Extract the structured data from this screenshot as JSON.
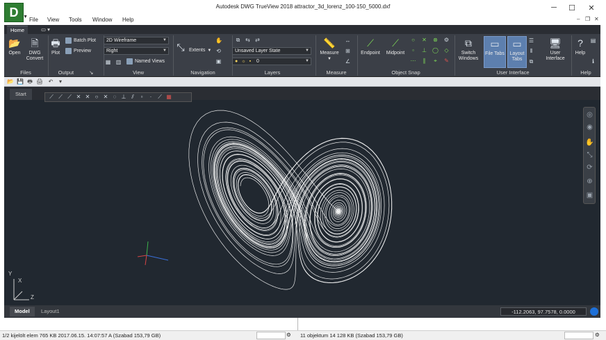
{
  "window": {
    "title": "Autodesk DWG TrueView 2018    attractor_3d_lorenz_100-150_5000.dxf",
    "logo_letter": "D"
  },
  "menu": [
    "File",
    "View",
    "Tools",
    "Window",
    "Help"
  ],
  "ribbon": {
    "tabs": [
      "Home"
    ],
    "panels": [
      "Files",
      "Output",
      "View",
      "Navigation",
      "Layers",
      "Measure",
      "Object Snap",
      "User Interface",
      "Help"
    ],
    "files": {
      "open": "Open",
      "dwg_convert_1": "DWG",
      "dwg_convert_2": "Convert"
    },
    "output": {
      "plot": "Plot",
      "batch_plot": "Batch Plot",
      "preview": "Preview"
    },
    "view": {
      "visual_style": "2D Wireframe",
      "view_dir": "Right",
      "named_views": "Named Views"
    },
    "navigation": {
      "extents": "Extents"
    },
    "layers": {
      "layer_state": "Unsaved Layer State",
      "layer_value": "0"
    },
    "measure": {
      "measure": "Measure"
    },
    "object_snap": {
      "endpoint": "Endpoint",
      "midpoint": "Midpoint"
    },
    "user_interface": {
      "switch_windows_1": "Switch",
      "switch_windows_2": "Windows",
      "file_tabs": "File Tabs",
      "layout_tabs_1": "Layout",
      "layout_tabs_2": "Tabs",
      "user_interface_1": "User",
      "user_interface_2": "Interface"
    },
    "help": {
      "help": "Help"
    }
  },
  "file_tabs": [
    "Start"
  ],
  "layout_tabs": [
    "Model",
    "Layout1"
  ],
  "coordinates": "-112.2063, 97.7578, 0.0000",
  "ucs": {
    "y": "Y",
    "x": "X",
    "z": "Z"
  },
  "explorer_status": {
    "left": "1/2 kijelölt elem   765 KB  2017.06.15. 14:07:57  A   (Szabad 153,79 GB)",
    "right": "11 objektum   14 128 KB   (Szabad 153,79 GB)"
  },
  "colors": {
    "canvas": "#212830",
    "ribbon": "#3b3f47",
    "curve": "#ffffff",
    "accent": "#5d7fae"
  }
}
